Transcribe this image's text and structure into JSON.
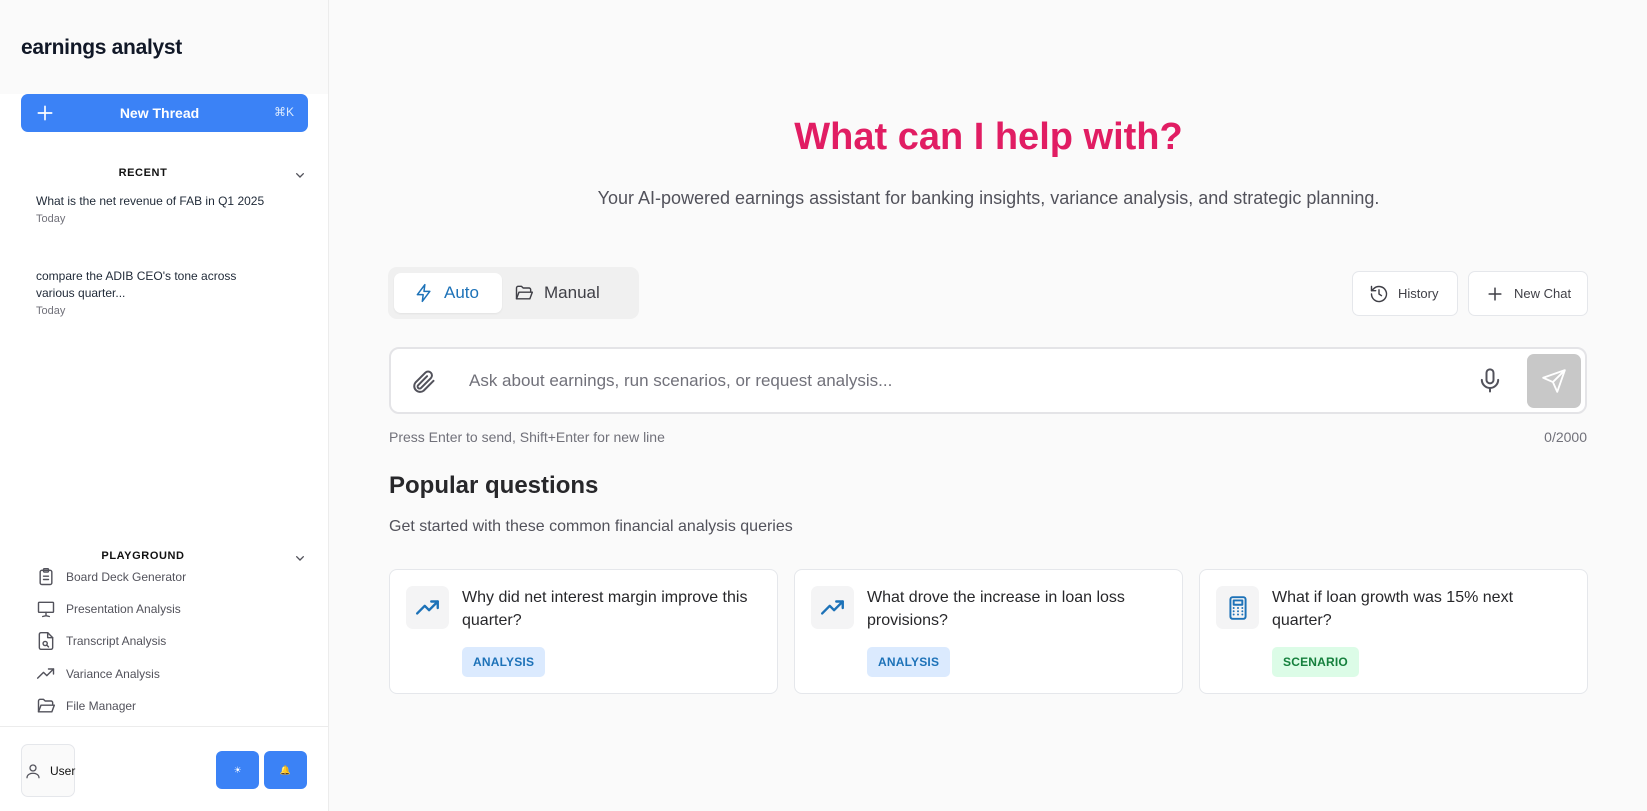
{
  "sidebar": {
    "brand": "earnings analyst",
    "new_thread": {
      "label": "New Thread",
      "shortcut": "⌘K"
    },
    "recent": {
      "title": "RECENT",
      "items": [
        {
          "question": "What is the net revenue of FAB in Q1 2025",
          "date": "Today"
        },
        {
          "question": "compare the ADIB CEO's tone across various quarter...",
          "date": "Today"
        }
      ]
    },
    "playground": {
      "title": "PLAYGROUND",
      "items": [
        {
          "label": "Board Deck Generator",
          "icon": "clipboard-icon"
        },
        {
          "label": "Presentation Analysis",
          "icon": "presentation-icon"
        },
        {
          "label": "Transcript Analysis",
          "icon": "file-search-icon"
        },
        {
          "label": "Variance Analysis",
          "icon": "trending-up-icon"
        },
        {
          "label": "File Manager",
          "icon": "folder-open-icon"
        }
      ]
    },
    "user": {
      "name": "User",
      "btn1": "☀",
      "btn2": "🔔"
    }
  },
  "main": {
    "title": "What can I help with?",
    "subtitle": "Your AI-powered earnings assistant for banking insights, variance analysis, and strategic planning.",
    "modes": {
      "auto": "Auto",
      "manual": "Manual"
    },
    "history_label": "History",
    "new_chat_label": "New Chat",
    "composer": {
      "placeholder": "Ask about earnings, run scenarios, or request analysis...",
      "value": ""
    },
    "hint": "Press Enter to send, Shift+Enter for new line",
    "counter": "0/2000",
    "popular": {
      "title": "Popular questions",
      "subtitle": "Get started with these common financial analysis queries",
      "cards": [
        {
          "question": "Why did net interest margin improve this quarter?",
          "tag": "ANALYSIS",
          "icon": "trending-up-icon"
        },
        {
          "question": "What drove the increase in loan loss provisions?",
          "tag": "ANALYSIS",
          "icon": "trending-up-icon"
        },
        {
          "question": "What if loan growth was 15% next quarter?",
          "tag": "SCENARIO",
          "icon": "calculator-icon"
        }
      ]
    }
  },
  "colors": {
    "accent": "#3b82f6",
    "title": "#e11d63",
    "analysis_tag_bg": "#dbeafe",
    "scenario_tag_bg": "#dcfce7"
  }
}
